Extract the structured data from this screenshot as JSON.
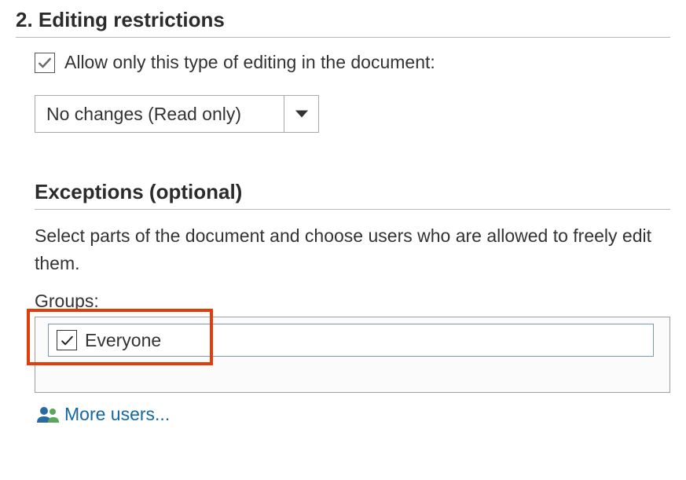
{
  "section": {
    "heading": "2. Editing restrictions",
    "allow_label": "Allow only this type of editing in the document:",
    "restriction_type": "No changes (Read only)"
  },
  "exceptions": {
    "heading": "Exceptions (optional)",
    "description": "Select parts of the document and choose users who are allowed to freely edit them.",
    "groups_label": "Groups:",
    "group_everyone": "Everyone",
    "more_users": "More users..."
  }
}
